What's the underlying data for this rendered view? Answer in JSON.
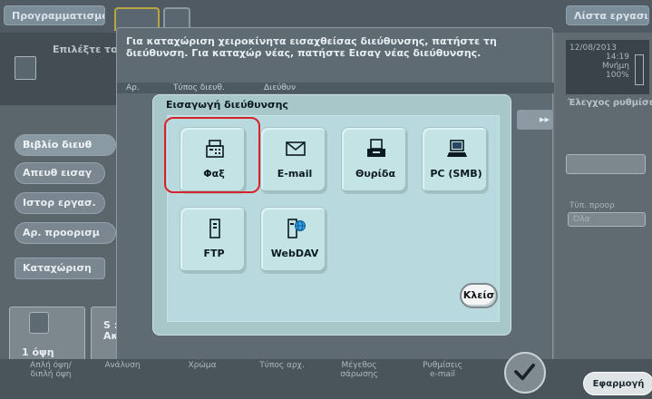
{
  "top": {
    "programs_label": "Προγραμματισμός",
    "job_list_label": "Λίστα εργασιών"
  },
  "header": {
    "select_text": "Επιλέξτε τον"
  },
  "status": {
    "date": "12/08/2013",
    "time": "14:19",
    "memory_label": "Μνήμη",
    "memory_value": "100%",
    "check_settings": "Έλεγχος ρυθμίσε"
  },
  "left_menu": [
    {
      "label": "Βιβλίο διευθ"
    },
    {
      "label": "Απευθ εισαγ"
    },
    {
      "label": "Ιστορ εργασ."
    },
    {
      "label": "Αρ. προορισμ"
    },
    {
      "label": "Καταχώριση"
    }
  ],
  "info_dialog": {
    "message": "Για καταχώριση χειροκίνητα εισαχθείσας διεύθυνσης, πατήστε τη διεύθυνση. Για καταχώρ νέας, πατήστε Εισαγ νέας διεύθυνσης.",
    "col_no": "Αρ.",
    "col_type": "Τύπος διευθ.",
    "col_address": "Διεύθυν"
  },
  "modal": {
    "title": "Εισαγωγή διεύθυνσης",
    "tiles": [
      {
        "label": "Φαξ",
        "icon": "fax-icon"
      },
      {
        "label": "E-mail",
        "icon": "envelope-icon"
      },
      {
        "label": "Θυρίδα",
        "icon": "user-box-icon"
      },
      {
        "label": "PC (SMB)",
        "icon": "computer-icon"
      },
      {
        "label": "FTP",
        "icon": "server-icon"
      },
      {
        "label": "WebDAV",
        "icon": "webdav-icon"
      }
    ],
    "close_label": "Κλείσ"
  },
  "right_panel": {
    "filter_label": "Τύπ. προορ",
    "filter_value": "Όλα"
  },
  "bottom_left": {
    "copies_label": "1 όψη",
    "side_label": "S :",
    "side_label2": "Ακ"
  },
  "bottom": {
    "items": [
      {
        "line1": "Απλή όψη/",
        "line2": "διπλή όψη"
      },
      {
        "line1": "Ανάλυση",
        "line2": ""
      },
      {
        "line1": "Χρώμα",
        "line2": ""
      },
      {
        "line1": "Τύπος αρχ.",
        "line2": ""
      },
      {
        "line1": "Μέγεθος",
        "line2": "σάρωσης"
      },
      {
        "line1": "Ρυθμίσεις",
        "line2": "e-mail"
      }
    ],
    "apply_label": "Εφαρμογή"
  },
  "colors": {
    "highlight": "#d8232a",
    "modal_bg": "#a7c7c9"
  }
}
